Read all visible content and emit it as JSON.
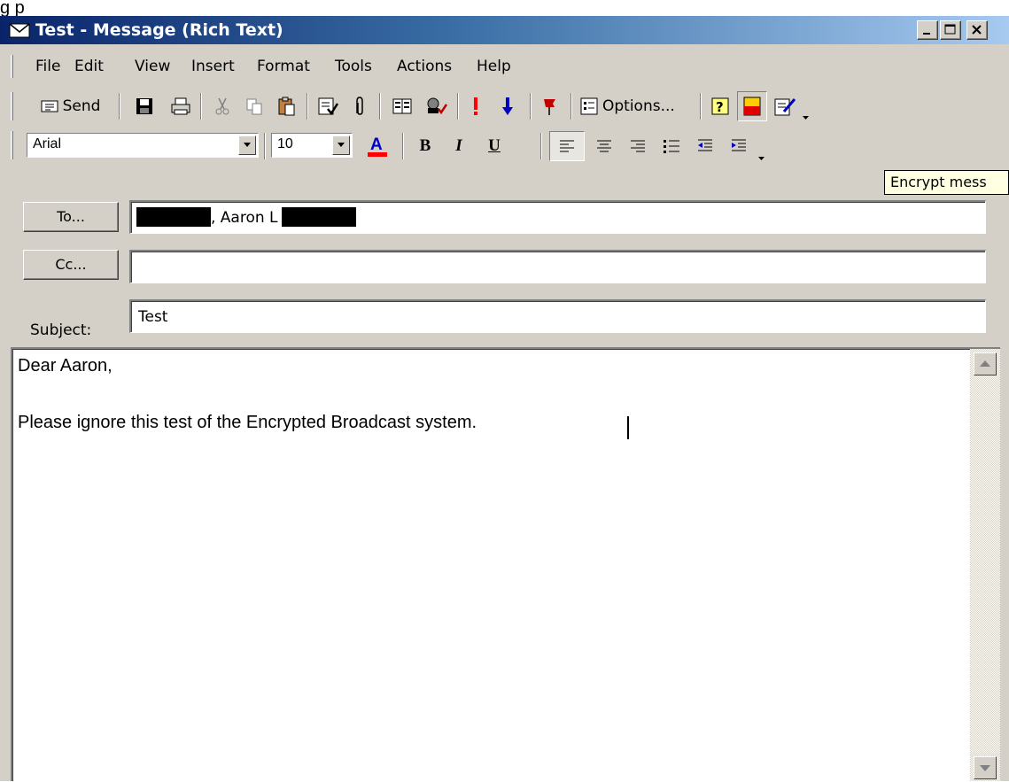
{
  "caption": {
    "partial_text": "g                   p"
  },
  "window": {
    "title": "Test - Message (Rich Text)",
    "controls": [
      "minimize",
      "maximize",
      "close"
    ]
  },
  "menu": {
    "items": [
      "File",
      "Edit",
      "View",
      "Insert",
      "Format",
      "Tools",
      "Actions",
      "Help"
    ]
  },
  "standard_toolbar": {
    "send_label": "Send",
    "options_label": "Options...",
    "icons": [
      "send-icon",
      "save-icon",
      "print-icon",
      "cut-icon",
      "copy-icon",
      "paste-icon",
      "check-names-icon",
      "attach-icon",
      "address-book-icon",
      "spell-check-icon",
      "high-importance-icon",
      "low-importance-icon",
      "flag-icon",
      "options-icon",
      "help-icon",
      "sign-icon",
      "encrypt-icon"
    ]
  },
  "format_toolbar": {
    "font": "Arial",
    "size": "10",
    "bold": "B",
    "italic": "I",
    "underline": "U",
    "font_color": "#ff0000"
  },
  "tooltip": {
    "text": "Encrypt mess"
  },
  "header": {
    "to_button": "To...",
    "cc_button": "Cc...",
    "to_value": ", Aaron L",
    "cc_value": "",
    "subject_label": "Subject:",
    "subject_value": "Test"
  },
  "body": {
    "line1": "Dear Aaron,",
    "line2": "Please ignore this test of the Encrypted Broadcast system."
  },
  "colors": {
    "title_start": "#0a246a",
    "title_end": "#a6caf0",
    "chrome": "#d4d0c8",
    "tooltip_bg": "#ffffe1"
  }
}
